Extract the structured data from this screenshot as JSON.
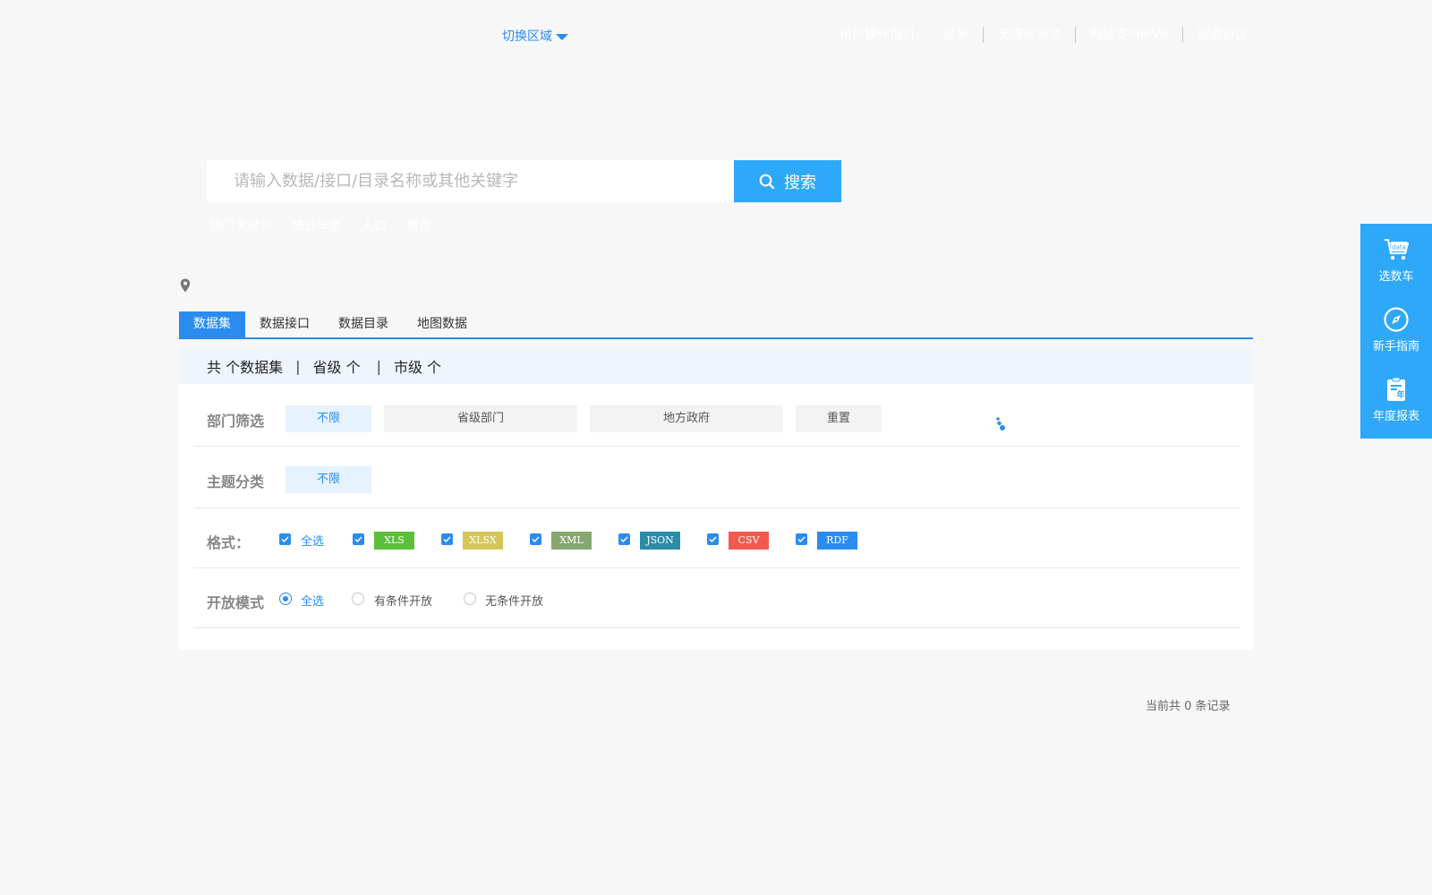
{
  "header": {
    "region_switch": "切换区域",
    "links": [
      {
        "label": "用户操作指引"
      },
      {
        "label": "登录"
      },
      {
        "label": "无障碍浏览"
      },
      {
        "label": "网站支持IPV6"
      },
      {
        "label": "服务协议"
      }
    ]
  },
  "search": {
    "placeholder": "请输入数据/接口/目录名称或其他关键字",
    "button_label": "搜索",
    "hot_keywords_label": "热门关键词",
    "hot_keywords": [
      "统计年鉴",
      "人口",
      "教育"
    ]
  },
  "tabs": [
    {
      "label": "数据集",
      "active": true
    },
    {
      "label": "数据接口"
    },
    {
      "label": "数据目录"
    },
    {
      "label": "地图数据"
    }
  ],
  "summary": {
    "total": "共 个数据集",
    "provincial": "省级 个",
    "city": "市级 个",
    "pipe": "|"
  },
  "filters": {
    "department": {
      "label": "部门筛选",
      "options": [
        "不限",
        "省级部门",
        "地方政府",
        "重置"
      ]
    },
    "topic": {
      "label": "主题分类",
      "options": [
        "不限"
      ]
    },
    "format": {
      "label": "格式：",
      "select_all": "全选",
      "items": [
        {
          "label": "XLS",
          "color": "#5cbf3a"
        },
        {
          "label": "XLSX",
          "color": "#d6c65a"
        },
        {
          "label": "XML",
          "color": "#86a870"
        },
        {
          "label": "JSON",
          "color": "#2b8ca8"
        },
        {
          "label": "CSV",
          "color": "#f25a4e"
        },
        {
          "label": "RDF",
          "color": "#2b8cf0"
        }
      ]
    },
    "open_mode": {
      "label": "开放模式",
      "options": [
        "全选",
        "有条件开放",
        "无条件开放"
      ]
    }
  },
  "records": "当前共 0 条记录",
  "dock": [
    {
      "label": "选数车",
      "icon": "data-cart-icon"
    },
    {
      "label": "新手指南",
      "icon": "compass-icon"
    },
    {
      "label": "年度报表",
      "icon": "annual-report-icon"
    }
  ],
  "colors": {
    "accent": "#2b8cf0",
    "dock_bg": "#2ea8f8",
    "search_btn": "#2ea8f8"
  }
}
